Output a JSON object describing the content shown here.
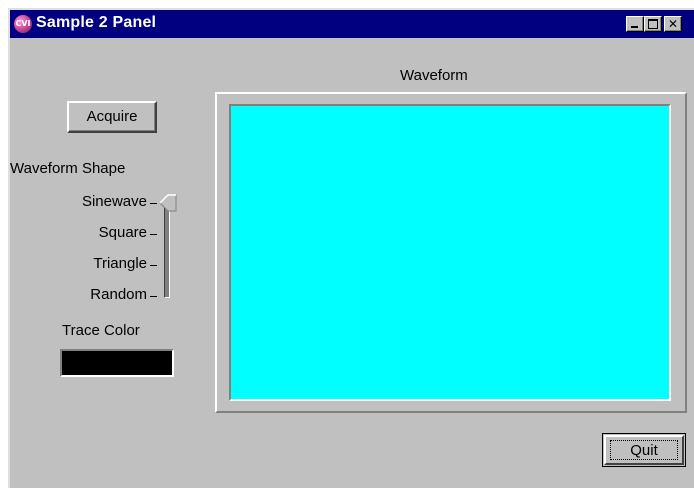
{
  "window": {
    "title": "Sample 2 Panel",
    "app_icon_text": "CVI"
  },
  "controls": {
    "acquire_label": "Acquire",
    "quit_label": "Quit",
    "waveform_label": "Waveform",
    "waveform_shape": {
      "label": "Waveform Shape",
      "options": [
        "Sinewave",
        "Square",
        "Triangle",
        "Random"
      ],
      "selected": "Sinewave"
    },
    "trace_color": {
      "label": "Trace Color",
      "value": "#000000"
    }
  },
  "graph": {
    "plot_background": "#00ffff"
  },
  "colors": {
    "titlebar": "#000080",
    "panel": "#c0c0c0"
  }
}
